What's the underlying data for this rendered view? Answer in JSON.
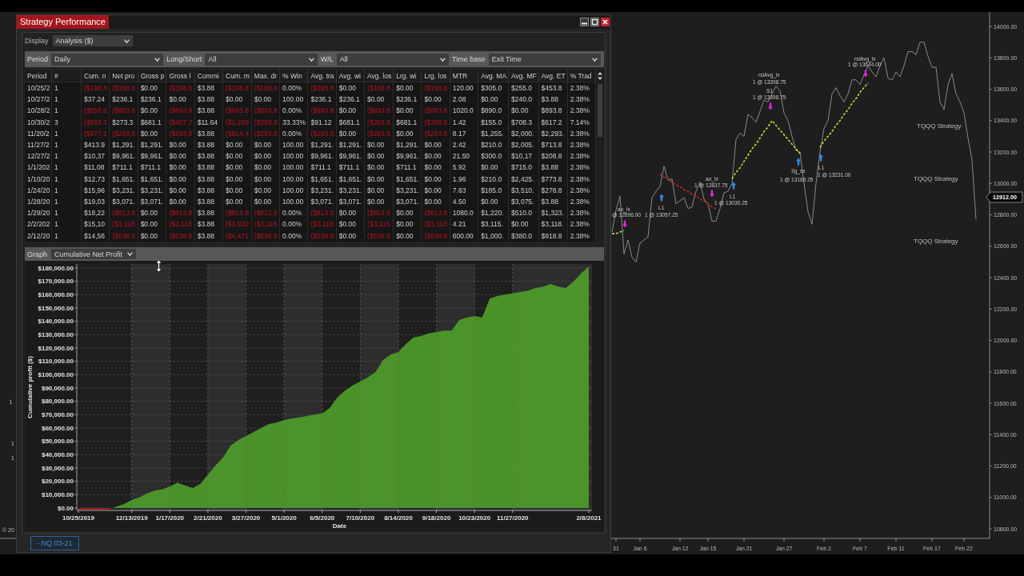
{
  "window": {
    "title": "Strategy Performance"
  },
  "display": {
    "label": "Display",
    "value": "Analysis ($)"
  },
  "filters": [
    {
      "label": "Period",
      "value": "Daily"
    },
    {
      "label": "Long/Short",
      "value": "All"
    },
    {
      "label": "W/L",
      "value": "All"
    },
    {
      "label": "Time base",
      "value": "Exit Time"
    }
  ],
  "table": {
    "columns": [
      "Period",
      "#",
      "Cum. n",
      "Net pro",
      "Gross p",
      "Gross l",
      "Commi",
      "Cum. m",
      "Max. dr",
      "% Win",
      "Avg. tra",
      "Avg. wi",
      "Avg. los",
      "Lrg. wi",
      "Lrg. los",
      "MTR",
      "Avg. MA",
      "Avg. MF",
      "Avg. ET",
      "% Trad"
    ],
    "rows": [
      {
        "cells": [
          {
            "text": "10/25/2",
            "negative": false
          },
          {
            "text": "1",
            "negative": false
          },
          {
            "text": "($198.8",
            "negative": true
          },
          {
            "text": "($198.8",
            "negative": true
          },
          {
            "text": "$0.00",
            "negative": false
          },
          {
            "text": "($198.8",
            "negative": true
          },
          {
            "text": "$3.88",
            "negative": false
          },
          {
            "text": "($198.8",
            "negative": true
          },
          {
            "text": "($198.8",
            "negative": true
          },
          {
            "text": "0.00%",
            "negative": false
          },
          {
            "text": "($198.8",
            "negative": true
          },
          {
            "text": "$0.00",
            "negative": false
          },
          {
            "text": "($198.8",
            "negative": true
          },
          {
            "text": "$0.00",
            "negative": false
          },
          {
            "text": "($198.8",
            "negative": true
          },
          {
            "text": "120.00",
            "negative": false
          },
          {
            "text": "$305.0",
            "negative": false
          },
          {
            "text": "$255.0",
            "negative": false
          },
          {
            "text": "$453.8",
            "negative": false
          },
          {
            "text": "2.38%",
            "negative": false
          }
        ]
      },
      {
        "cells": [
          {
            "text": "10/27/2",
            "negative": false
          },
          {
            "text": "1",
            "negative": false
          },
          {
            "text": "$37.24",
            "negative": false
          },
          {
            "text": "$236.1",
            "negative": false
          },
          {
            "text": "$236.1",
            "negative": false
          },
          {
            "text": "$0.00",
            "negative": false
          },
          {
            "text": "$3.88",
            "negative": false
          },
          {
            "text": "$0.00",
            "negative": false
          },
          {
            "text": "$0.00",
            "negative": false
          },
          {
            "text": "100.00",
            "negative": false
          },
          {
            "text": "$236.1",
            "negative": false
          },
          {
            "text": "$236.1",
            "negative": false
          },
          {
            "text": "$0.00",
            "negative": false
          },
          {
            "text": "$236.1",
            "negative": false
          },
          {
            "text": "$0.00",
            "negative": false
          },
          {
            "text": "2.08",
            "negative": false
          },
          {
            "text": "$0.00",
            "negative": false
          },
          {
            "text": "$240.0",
            "negative": false
          },
          {
            "text": "$3.88",
            "negative": false
          },
          {
            "text": "2.38%",
            "negative": false
          }
        ]
      },
      {
        "cells": [
          {
            "text": "10/28/2",
            "negative": false
          },
          {
            "text": "1",
            "negative": false
          },
          {
            "text": "($856.6",
            "negative": true
          },
          {
            "text": "($893.8",
            "negative": true
          },
          {
            "text": "$0.00",
            "negative": false
          },
          {
            "text": "($893.8",
            "negative": true
          },
          {
            "text": "$3.88",
            "negative": false
          },
          {
            "text": "($893.8",
            "negative": true
          },
          {
            "text": "($893.8",
            "negative": true
          },
          {
            "text": "0.00%",
            "negative": false
          },
          {
            "text": "($893.8",
            "negative": true
          },
          {
            "text": "$0.00",
            "negative": false
          },
          {
            "text": "($893.8",
            "negative": true
          },
          {
            "text": "$0.00",
            "negative": false
          },
          {
            "text": "($893.8",
            "negative": true
          },
          {
            "text": "1020.0",
            "negative": false
          },
          {
            "text": "$890.0",
            "negative": false
          },
          {
            "text": "$0.00",
            "negative": false
          },
          {
            "text": "$893.8",
            "negative": false
          },
          {
            "text": "2.38%",
            "negative": false
          }
        ]
      },
      {
        "cells": [
          {
            "text": "10/30/2",
            "negative": false
          },
          {
            "text": "3",
            "negative": false
          },
          {
            "text": "($583.3",
            "negative": true
          },
          {
            "text": "$273.3",
            "negative": false
          },
          {
            "text": "$681.1",
            "negative": false
          },
          {
            "text": "($407.7",
            "negative": true
          },
          {
            "text": "$11.64",
            "negative": false
          },
          {
            "text": "($1,289",
            "negative": true
          },
          {
            "text": "($368.8",
            "negative": true
          },
          {
            "text": "33.33%",
            "negative": false
          },
          {
            "text": "$91.12",
            "negative": false
          },
          {
            "text": "$681.1",
            "negative": false
          },
          {
            "text": "($203.8",
            "negative": true
          },
          {
            "text": "$681.1",
            "negative": false
          },
          {
            "text": "($368.8",
            "negative": true
          },
          {
            "text": "1.42",
            "negative": false
          },
          {
            "text": "$155.0",
            "negative": false
          },
          {
            "text": "$708.3",
            "negative": false
          },
          {
            "text": "$617.2",
            "negative": false
          },
          {
            "text": "7.14%",
            "negative": false
          }
        ]
      },
      {
        "cells": [
          {
            "text": "11/20/2",
            "negative": false
          },
          {
            "text": "1",
            "negative": false
          },
          {
            "text": "($877.1",
            "negative": true
          },
          {
            "text": "($293.8",
            "negative": true
          },
          {
            "text": "$0.00",
            "negative": false
          },
          {
            "text": "($293.8",
            "negative": true
          },
          {
            "text": "$3.88",
            "negative": false
          },
          {
            "text": "($914.4",
            "negative": true
          },
          {
            "text": "($293.8",
            "negative": true
          },
          {
            "text": "0.00%",
            "negative": false
          },
          {
            "text": "($293.8",
            "negative": true
          },
          {
            "text": "$0.00",
            "negative": false
          },
          {
            "text": "($293.8",
            "negative": true
          },
          {
            "text": "$0.00",
            "negative": false
          },
          {
            "text": "($293.8",
            "negative": true
          },
          {
            "text": "8.17",
            "negative": false
          },
          {
            "text": "$1,255.",
            "negative": false
          },
          {
            "text": "$2,000.",
            "negative": false
          },
          {
            "text": "$2,293.",
            "negative": false
          },
          {
            "text": "2.38%",
            "negative": false
          }
        ]
      },
      {
        "cells": [
          {
            "text": "11/27/2",
            "negative": false
          },
          {
            "text": "1",
            "negative": false
          },
          {
            "text": "$413.9",
            "negative": false
          },
          {
            "text": "$1,291.",
            "negative": false
          },
          {
            "text": "$1,291.",
            "negative": false
          },
          {
            "text": "$0.00",
            "negative": false
          },
          {
            "text": "$3.88",
            "negative": false
          },
          {
            "text": "$0.00",
            "negative": false
          },
          {
            "text": "$0.00",
            "negative": false
          },
          {
            "text": "100.00",
            "negative": false
          },
          {
            "text": "$1,291.",
            "negative": false
          },
          {
            "text": "$1,291.",
            "negative": false
          },
          {
            "text": "$0.00",
            "negative": false
          },
          {
            "text": "$1,291.",
            "negative": false
          },
          {
            "text": "$0.00",
            "negative": false
          },
          {
            "text": "2.42",
            "negative": false
          },
          {
            "text": "$210.0",
            "negative": false
          },
          {
            "text": "$2,005.",
            "negative": false
          },
          {
            "text": "$713.8",
            "negative": false
          },
          {
            "text": "2.38%",
            "negative": false
          }
        ]
      },
      {
        "cells": [
          {
            "text": "12/27/2",
            "negative": false
          },
          {
            "text": "1",
            "negative": false
          },
          {
            "text": "$10,37",
            "negative": false
          },
          {
            "text": "$9,961.",
            "negative": false
          },
          {
            "text": "$9,961.",
            "negative": false
          },
          {
            "text": "$0.00",
            "negative": false
          },
          {
            "text": "$3.88",
            "negative": false
          },
          {
            "text": "$0.00",
            "negative": false
          },
          {
            "text": "$0.00",
            "negative": false
          },
          {
            "text": "100.00",
            "negative": false
          },
          {
            "text": "$9,961.",
            "negative": false
          },
          {
            "text": "$9,961.",
            "negative": false
          },
          {
            "text": "$0.00",
            "negative": false
          },
          {
            "text": "$9,961.",
            "negative": false
          },
          {
            "text": "$0.00",
            "negative": false
          },
          {
            "text": "21.50",
            "negative": false
          },
          {
            "text": "$300.0",
            "negative": false
          },
          {
            "text": "$10,17",
            "negative": false
          },
          {
            "text": "$208.8",
            "negative": false
          },
          {
            "text": "2.38%",
            "negative": false
          }
        ]
      },
      {
        "cells": [
          {
            "text": "1/1/202",
            "negative": false
          },
          {
            "text": "1",
            "negative": false
          },
          {
            "text": "$11,08",
            "negative": false
          },
          {
            "text": "$711.1",
            "negative": false
          },
          {
            "text": "$711.1",
            "negative": false
          },
          {
            "text": "$0.00",
            "negative": false
          },
          {
            "text": "$3.88",
            "negative": false
          },
          {
            "text": "$0.00",
            "negative": false
          },
          {
            "text": "$0.00",
            "negative": false
          },
          {
            "text": "100.00",
            "negative": false
          },
          {
            "text": "$711.1",
            "negative": false
          },
          {
            "text": "$711.1",
            "negative": false
          },
          {
            "text": "$0.00",
            "negative": false
          },
          {
            "text": "$711.1",
            "negative": false
          },
          {
            "text": "$0.00",
            "negative": false
          },
          {
            "text": "5.92",
            "negative": false
          },
          {
            "text": "$0.00",
            "negative": false
          },
          {
            "text": "$715.0",
            "negative": false
          },
          {
            "text": "$3.88",
            "negative": false
          },
          {
            "text": "2.38%",
            "negative": false
          }
        ]
      },
      {
        "cells": [
          {
            "text": "1/10/20",
            "negative": false
          },
          {
            "text": "1",
            "negative": false
          },
          {
            "text": "$12,73",
            "negative": false
          },
          {
            "text": "$1,651.",
            "negative": false
          },
          {
            "text": "$1,651.",
            "negative": false
          },
          {
            "text": "$0.00",
            "negative": false
          },
          {
            "text": "$3.88",
            "negative": false
          },
          {
            "text": "$0.00",
            "negative": false
          },
          {
            "text": "$0.00",
            "negative": false
          },
          {
            "text": "100.00",
            "negative": false
          },
          {
            "text": "$1,651.",
            "negative": false
          },
          {
            "text": "$1,651.",
            "negative": false
          },
          {
            "text": "$0.00",
            "negative": false
          },
          {
            "text": "$1,651.",
            "negative": false
          },
          {
            "text": "$0.00",
            "negative": false
          },
          {
            "text": "1.96",
            "negative": false
          },
          {
            "text": "$210.0",
            "negative": false
          },
          {
            "text": "$2,425.",
            "negative": false
          },
          {
            "text": "$773.8",
            "negative": false
          },
          {
            "text": "2.38%",
            "negative": false
          }
        ]
      },
      {
        "cells": [
          {
            "text": "1/24/20",
            "negative": false
          },
          {
            "text": "1",
            "negative": false
          },
          {
            "text": "$15,96",
            "negative": false
          },
          {
            "text": "$3,231.",
            "negative": false
          },
          {
            "text": "$3,231.",
            "negative": false
          },
          {
            "text": "$0.00",
            "negative": false
          },
          {
            "text": "$3.88",
            "negative": false
          },
          {
            "text": "$0.00",
            "negative": false
          },
          {
            "text": "$0.00",
            "negative": false
          },
          {
            "text": "100.00",
            "negative": false
          },
          {
            "text": "$3,231.",
            "negative": false
          },
          {
            "text": "$3,231.",
            "negative": false
          },
          {
            "text": "$0.00",
            "negative": false
          },
          {
            "text": "$3,231.",
            "negative": false
          },
          {
            "text": "$0.00",
            "negative": false
          },
          {
            "text": "7.63",
            "negative": false
          },
          {
            "text": "$185.0",
            "negative": false
          },
          {
            "text": "$3,510.",
            "negative": false
          },
          {
            "text": "$278.8",
            "negative": false
          },
          {
            "text": "2.38%",
            "negative": false
          }
        ]
      },
      {
        "cells": [
          {
            "text": "1/28/20",
            "negative": false
          },
          {
            "text": "1",
            "negative": false
          },
          {
            "text": "$19,03",
            "negative": false
          },
          {
            "text": "$3,071.",
            "negative": false
          },
          {
            "text": "$3,071.",
            "negative": false
          },
          {
            "text": "$0.00",
            "negative": false
          },
          {
            "text": "$3.88",
            "negative": false
          },
          {
            "text": "$0.00",
            "negative": false
          },
          {
            "text": "$0.00",
            "negative": false
          },
          {
            "text": "100.00",
            "negative": false
          },
          {
            "text": "$3,071.",
            "negative": false
          },
          {
            "text": "$3,071.",
            "negative": false
          },
          {
            "text": "$0.00",
            "negative": false
          },
          {
            "text": "$3,071.",
            "negative": false
          },
          {
            "text": "$0.00",
            "negative": false
          },
          {
            "text": "4.50",
            "negative": false
          },
          {
            "text": "$0.00",
            "negative": false
          },
          {
            "text": "$3,075.",
            "negative": false
          },
          {
            "text": "$3.88",
            "negative": false
          },
          {
            "text": "2.38%",
            "negative": false
          }
        ]
      },
      {
        "cells": [
          {
            "text": "1/29/20",
            "negative": false
          },
          {
            "text": "1",
            "negative": false
          },
          {
            "text": "$18,22",
            "negative": false
          },
          {
            "text": "($813.8",
            "negative": true
          },
          {
            "text": "$0.00",
            "negative": false
          },
          {
            "text": "($813.8",
            "negative": true
          },
          {
            "text": "$3.88",
            "negative": false
          },
          {
            "text": "($813.8",
            "negative": true
          },
          {
            "text": "($813.8",
            "negative": true
          },
          {
            "text": "0.00%",
            "negative": false
          },
          {
            "text": "($813.8",
            "negative": true
          },
          {
            "text": "$0.00",
            "negative": false
          },
          {
            "text": "($813.8",
            "negative": true
          },
          {
            "text": "$0.00",
            "negative": false
          },
          {
            "text": "($813.8",
            "negative": true
          },
          {
            "text": "1080.0",
            "negative": false
          },
          {
            "text": "$1,220.",
            "negative": false
          },
          {
            "text": "$510.0",
            "negative": false
          },
          {
            "text": "$1,323.",
            "negative": false
          },
          {
            "text": "2.38%",
            "negative": false
          }
        ]
      },
      {
        "cells": [
          {
            "text": "2/2/202",
            "negative": false
          },
          {
            "text": "1",
            "negative": false
          },
          {
            "text": "$15,10",
            "negative": false
          },
          {
            "text": "($3,118",
            "negative": true
          },
          {
            "text": "$0.00",
            "negative": false
          },
          {
            "text": "($3,118",
            "negative": true
          },
          {
            "text": "$3.88",
            "negative": false
          },
          {
            "text": "($3,932",
            "negative": true
          },
          {
            "text": "($3,118",
            "negative": true
          },
          {
            "text": "0.00%",
            "negative": false
          },
          {
            "text": "($3,118",
            "negative": true
          },
          {
            "text": "$0.00",
            "negative": false
          },
          {
            "text": "($3,118",
            "negative": true
          },
          {
            "text": "$0.00",
            "negative": false
          },
          {
            "text": "($3,118",
            "negative": true
          },
          {
            "text": "4.21",
            "negative": false
          },
          {
            "text": "$3,115.",
            "negative": false
          },
          {
            "text": "$0.00",
            "negative": false
          },
          {
            "text": "$3,118.",
            "negative": false
          },
          {
            "text": "2.38%",
            "negative": false
          }
        ]
      },
      {
        "cells": [
          {
            "text": "2/12/20",
            "negative": false
          },
          {
            "text": "1",
            "negative": false
          },
          {
            "text": "$14,56",
            "negative": false
          },
          {
            "text": "($538.8",
            "negative": true
          },
          {
            "text": "$0.00",
            "negative": false
          },
          {
            "text": "($538.8",
            "negative": true
          },
          {
            "text": "$3.88",
            "negative": false
          },
          {
            "text": "($4,471",
            "negative": true
          },
          {
            "text": "($538.8",
            "negative": true
          },
          {
            "text": "0.00%",
            "negative": false
          },
          {
            "text": "($538.8",
            "negative": true
          },
          {
            "text": "$0.00",
            "negative": false
          },
          {
            "text": "($538.8",
            "negative": true
          },
          {
            "text": "$0.00",
            "negative": false
          },
          {
            "text": "($538.8",
            "negative": true
          },
          {
            "text": "600.00",
            "negative": false
          },
          {
            "text": "$1,000.",
            "negative": false
          },
          {
            "text": "$380.0",
            "negative": false
          },
          {
            "text": "$918.8",
            "negative": false
          },
          {
            "text": "2.38%",
            "negative": false
          }
        ]
      }
    ]
  },
  "graph": {
    "label": "Graph",
    "value": "Cumulative Net Profit",
    "chart_data": {
      "type": "area",
      "xlabel": "Date",
      "ylabel": "Cumulative profit ($)",
      "grid": true,
      "categories": [
        "10/25/2019",
        null,
        null,
        null,
        null,
        null,
        null,
        "12/13/2019",
        null,
        null,
        null,
        null,
        "1/17/2020",
        null,
        null,
        null,
        null,
        "2/21/2020",
        null,
        null,
        null,
        null,
        "3/27/2020",
        null,
        null,
        null,
        null,
        "5/1/2020",
        null,
        null,
        null,
        null,
        "6/5/2020",
        null,
        null,
        null,
        null,
        "7/10/2020",
        null,
        null,
        null,
        null,
        "8/14/2020",
        null,
        null,
        null,
        null,
        "9/18/2020",
        null,
        null,
        null,
        null,
        "10/23/2020",
        null,
        null,
        null,
        null,
        "11/27/2020",
        null,
        null,
        null,
        null,
        null,
        null,
        null,
        null,
        null,
        "2/8/2021"
      ],
      "series": [
        {
          "color": "#4e9e2a",
          "values": [
            -1000,
            -1000,
            -1000,
            -1000,
            -1000,
            1000,
            3000,
            6000,
            8000,
            11000,
            13000,
            14000,
            16000,
            19000,
            17000,
            15000,
            18000,
            25000,
            32000,
            38000,
            47000,
            51000,
            54000,
            57000,
            60000,
            63000,
            64000,
            66000,
            67000,
            68000,
            69000,
            70000,
            71000,
            75000,
            83000,
            88000,
            92000,
            95000,
            98000,
            102000,
            111000,
            115000,
            117000,
            123000,
            128000,
            129000,
            131000,
            132000,
            133000,
            133000,
            141000,
            143000,
            144000,
            143000,
            157000,
            159000,
            160000,
            161000,
            162000,
            163000,
            165000,
            166000,
            168000,
            166000,
            165000,
            170000,
            176000,
            181000
          ]
        }
      ],
      "ylim": [
        -1800,
        183000
      ],
      "yticks": [
        {
          "value": 0,
          "label": "$0.00"
        },
        {
          "value": 10000,
          "label": "$10,000.00"
        },
        {
          "value": 20000,
          "label": "$20,000.00"
        },
        {
          "value": 30000,
          "label": "$30,000.00"
        },
        {
          "value": 40000,
          "label": "$40,000.00"
        },
        {
          "value": 50000,
          "label": "$50,000.00"
        },
        {
          "value": 60000,
          "label": "$60,000.00"
        },
        {
          "value": 70000,
          "label": "$70,000.00"
        },
        {
          "value": 80000,
          "label": "$80,000.00"
        },
        {
          "value": 90000,
          "label": "$90,000.00"
        },
        {
          "value": 100000,
          "label": "$100,000.00"
        },
        {
          "value": 110000,
          "label": "$110,000.00"
        },
        {
          "value": 120000,
          "label": "$120,000.00"
        },
        {
          "value": 130000,
          "label": "$130,000.00"
        },
        {
          "value": 140000,
          "label": "$140,000.00"
        },
        {
          "value": 150000,
          "label": "$150,000.00"
        },
        {
          "value": 160000,
          "label": "$160,000.00"
        },
        {
          "value": 170000,
          "label": "$170,000.00"
        },
        {
          "value": 180000,
          "label": "$180,000.00"
        }
      ]
    }
  },
  "instrument_tabs": [
    {
      "label": "- NQ 03-21",
      "selected": true
    }
  ],
  "price_chart": {
    "chart_data": {
      "type": "line",
      "categories": [
        null,
        "31",
        null,
        null,
        null,
        null,
        null,
        "Jan 6",
        null,
        null,
        null,
        null,
        null,
        null,
        null,
        null,
        null,
        "Jan 12",
        null,
        null,
        null,
        null,
        null,
        null,
        "Jan 15",
        null,
        null,
        null,
        null,
        null,
        null,
        null,
        null,
        "Jan 21",
        null,
        null,
        null,
        null,
        null,
        null,
        null,
        null,
        null,
        "Jan 27",
        null,
        null,
        null,
        null,
        null,
        null,
        null,
        null,
        null,
        "Feb 2",
        null,
        null,
        null,
        null,
        null,
        null,
        null,
        null,
        "Feb 7",
        null,
        null,
        null,
        null,
        null,
        null,
        null,
        null,
        "Feb 11",
        null,
        null,
        null,
        null,
        null,
        null,
        null,
        null,
        "Feb 17",
        null,
        null,
        null,
        null,
        null,
        null,
        null,
        "Feb 22",
        null,
        null,
        null
      ],
      "series": [
        {
          "color": "#8a8a8a",
          "values": [
            12690,
            12830,
            12920,
            12550,
            12640,
            12530,
            12500,
            12620,
            12640,
            12660,
            12910,
            12950,
            12980,
            13110,
            13020,
            13030,
            12870,
            12890,
            12910,
            12840,
            12850,
            12950,
            13010,
            12900,
            12870,
            12760,
            12760,
            12840,
            12940,
            12950,
            13000,
            13280,
            13320,
            13300,
            13440,
            13420,
            13390,
            13460,
            13530,
            13520,
            13570,
            13620,
            13590,
            13450,
            13400,
            13300,
            13210,
            13200,
            13000,
            12820,
            12740,
            13000,
            13200,
            13350,
            13400,
            13570,
            13610,
            13560,
            13520,
            13570,
            13660,
            13660,
            13630,
            13690,
            13750,
            13710,
            13680,
            13750,
            13800,
            13670,
            13660,
            13710,
            13680,
            13750,
            13840,
            13840,
            13820,
            13900,
            13900,
            13810,
            13740,
            13740,
            13520,
            13470,
            13630,
            13700,
            13570,
            13520,
            13450,
            13290,
            13150,
            12770
          ]
        },
        {
          "color": "#b8e830",
          "line_style": "dashed",
          "values": [
            12680,
            12680,
            12690,
            12700,
            null,
            null,
            null,
            null,
            null,
            null,
            null,
            null,
            null,
            null,
            null,
            null,
            null,
            null,
            null,
            null,
            null,
            null,
            null,
            null,
            null,
            null,
            null,
            null,
            null,
            null,
            13030,
            13070,
            13100,
            13140,
            13180,
            13220,
            13250,
            13290,
            13330,
            13360,
            13400,
            13370,
            13340,
            13310,
            13280,
            13250,
            13220,
            13190,
            null,
            null,
            null,
            null,
            13230,
            13270,
            13300,
            13330,
            13370,
            13400,
            13440,
            13470,
            13510,
            13540,
            13580,
            13610,
            13640,
            null,
            null,
            null,
            null,
            null,
            null,
            null,
            null,
            null,
            null,
            null,
            null,
            null,
            null,
            null,
            null,
            null,
            null,
            null,
            null,
            null,
            null,
            null,
            null,
            null,
            null,
            null
          ]
        },
        {
          "color": "#c1272d",
          "line_style": "dashed",
          "values": [
            null,
            null,
            null,
            null,
            null,
            null,
            null,
            null,
            null,
            null,
            null,
            null,
            13060,
            13040,
            13030,
            13010,
            12990,
            12980,
            12960,
            12950,
            12930,
            12920,
            12900,
            12890,
            12870,
            12850,
            12840,
            null,
            null,
            null,
            null,
            null,
            null,
            null,
            null,
            null,
            null,
            null,
            null,
            null,
            null,
            null,
            null,
            null,
            null,
            null,
            null,
            null,
            null,
            null,
            null,
            null,
            null,
            null,
            null,
            null,
            null,
            null,
            null,
            null,
            null,
            null,
            null,
            null,
            null,
            null,
            null,
            null,
            null,
            null,
            null,
            null,
            null,
            null,
            null,
            null,
            null,
            null,
            null,
            null,
            null,
            null,
            null,
            null,
            null,
            null,
            null,
            null,
            null,
            null,
            null,
            null
          ]
        }
      ],
      "ylim": [
        10739,
        14092
      ],
      "yticks": [
        {
          "value": 14000,
          "label": "14000.00"
        },
        {
          "value": 13800,
          "label": "13800.00"
        },
        {
          "value": 13600,
          "label": "13600.00"
        },
        {
          "value": 13400,
          "label": "13400.00"
        },
        {
          "value": 13200,
          "label": "13200.00"
        },
        {
          "value": 13000,
          "label": "13000.00"
        },
        {
          "value": 12800,
          "label": "12800.00"
        },
        {
          "value": 12600,
          "label": "12600.00"
        },
        {
          "value": 12400,
          "label": "12400.00"
        },
        {
          "value": 12200,
          "label": "12200.00"
        },
        {
          "value": 12000,
          "label": "12000.00"
        },
        {
          "value": 11800,
          "label": "11800.00"
        },
        {
          "value": 11600,
          "label": "11600.00"
        },
        {
          "value": 11400,
          "label": "11400.00"
        },
        {
          "value": 11200,
          "label": "11200.00"
        },
        {
          "value": 11000,
          "label": "11000.00"
        },
        {
          "value": 10800,
          "label": "10800.00"
        }
      ]
    },
    "current_price": "12912.00",
    "annotations": [
      "rsiAvg_lx",
      "1 @ 13644.00",
      "rsiAvg_lx",
      "1 @ 13398.75",
      "S1",
      "1 @ 13398.75",
      "L1",
      "3g_sx",
      "1 @ 13231.00",
      "1 @ 13189.25",
      "ao_lx",
      "1 @ 12837.75",
      "L1",
      "1 @ 13030.25",
      "L1",
      "ao_lx",
      "@ 12696.00",
      "1 @ 13057.25",
      "1",
      "1",
      "1"
    ],
    "strategy_labels": [
      "TQQQ Strategy",
      "TQQQ Strategy",
      "TQQQ Strategy"
    ],
    "copyright": "© 20"
  }
}
